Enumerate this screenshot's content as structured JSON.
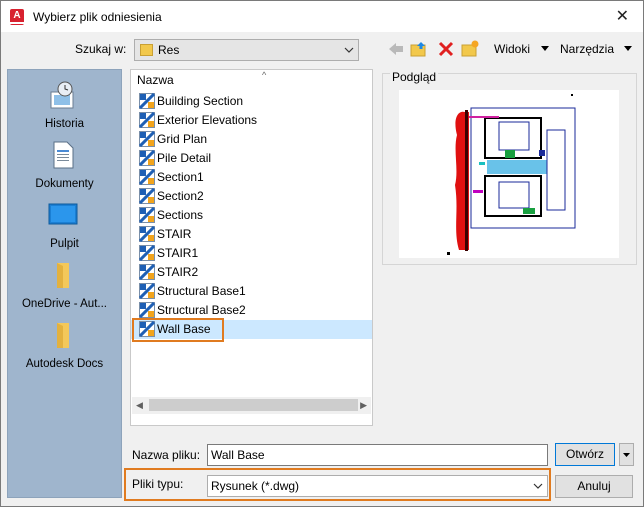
{
  "window": {
    "title": "Wybierz plik odniesienia",
    "close_glyph": "✕"
  },
  "lookin": {
    "label": "Szukaj w:",
    "value": "Res"
  },
  "toolbar": {
    "views_label": "Widoki",
    "tools_label": "Narzędzia"
  },
  "places": [
    {
      "label": "Historia",
      "icon": "history-icon"
    },
    {
      "label": "Dokumenty",
      "icon": "documents-icon"
    },
    {
      "label": "Pulpit",
      "icon": "desktop-icon"
    },
    {
      "label": "OneDrive - Aut...",
      "icon": "folder-icon"
    },
    {
      "label": "Autodesk Docs",
      "icon": "folder-icon"
    }
  ],
  "filelist": {
    "column_header": "Nazwa",
    "files": [
      "Building Section",
      "Exterior Elevations",
      "Grid Plan",
      "Pile Detail",
      "Section1",
      "Section2",
      "Sections",
      "STAIR",
      "STAIR1",
      "STAIR2",
      "Structural Base1",
      "Structural Base2",
      "Wall Base"
    ],
    "selected": "Wall Base"
  },
  "preview": {
    "label": "Podgląd"
  },
  "filename": {
    "label": "Nazwa pliku:",
    "value": "Wall Base"
  },
  "filetype": {
    "label": "Pliki typu:",
    "value": "Rysunek (*.dwg)"
  },
  "buttons": {
    "open": "Otwórz",
    "cancel": "Anuluj"
  },
  "colors": {
    "accent_highlight": "#e07b20",
    "selection": "#cce8ff",
    "places_bg": "#9fb5cd",
    "app_icon": "#d8212f"
  }
}
